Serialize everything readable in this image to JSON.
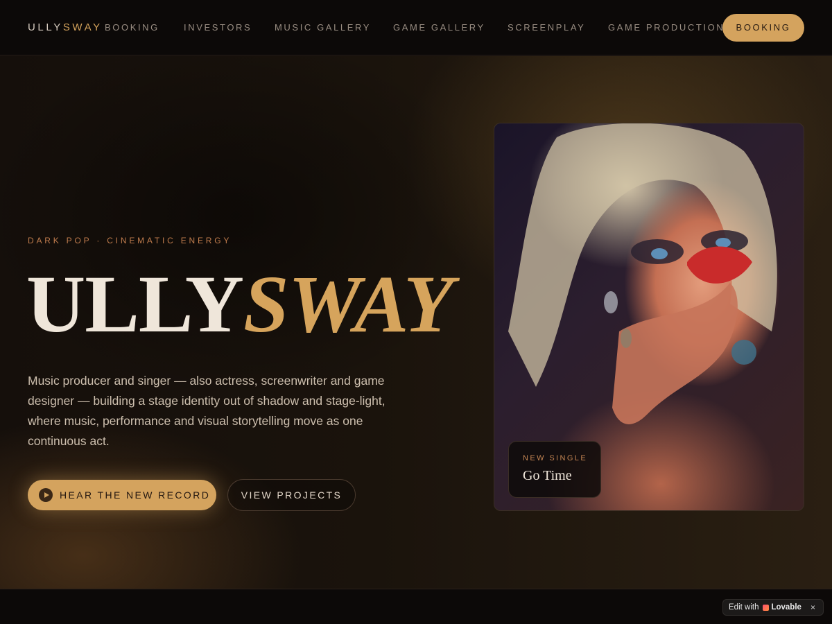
{
  "nav": {
    "brand_part1": "ULLY",
    "brand_part2": "SWAY",
    "links": [
      "BOOKING",
      "INVESTORS",
      "MUSIC GALLERY",
      "GAME GALLERY",
      "SCREENPLAY",
      "GAME PRODUCTION"
    ],
    "cta_label": "BOOKING"
  },
  "hero": {
    "eyebrow": "DARK POP · CINEMATIC ENERGY",
    "title_part1": "ULLY",
    "title_part2": "SWAY",
    "description": "Music producer and singer — also actress, screenwriter and game designer — building a stage identity out of shadow and stage-light, where music, performance and visual storytelling move as one continuous act.",
    "primary_button": "HEAR THE NEW RECORD",
    "secondary_button": "VIEW PROJECTS"
  },
  "photo_card": {
    "label": "NEW SINGLE",
    "title": "Go Time"
  },
  "badge": {
    "edit_text": "Edit with",
    "brand": "Lovable",
    "close": "×"
  },
  "colors": {
    "accent": "#d4a35e",
    "eyebrow": "#c07c4d",
    "background": "#0e0a08"
  }
}
